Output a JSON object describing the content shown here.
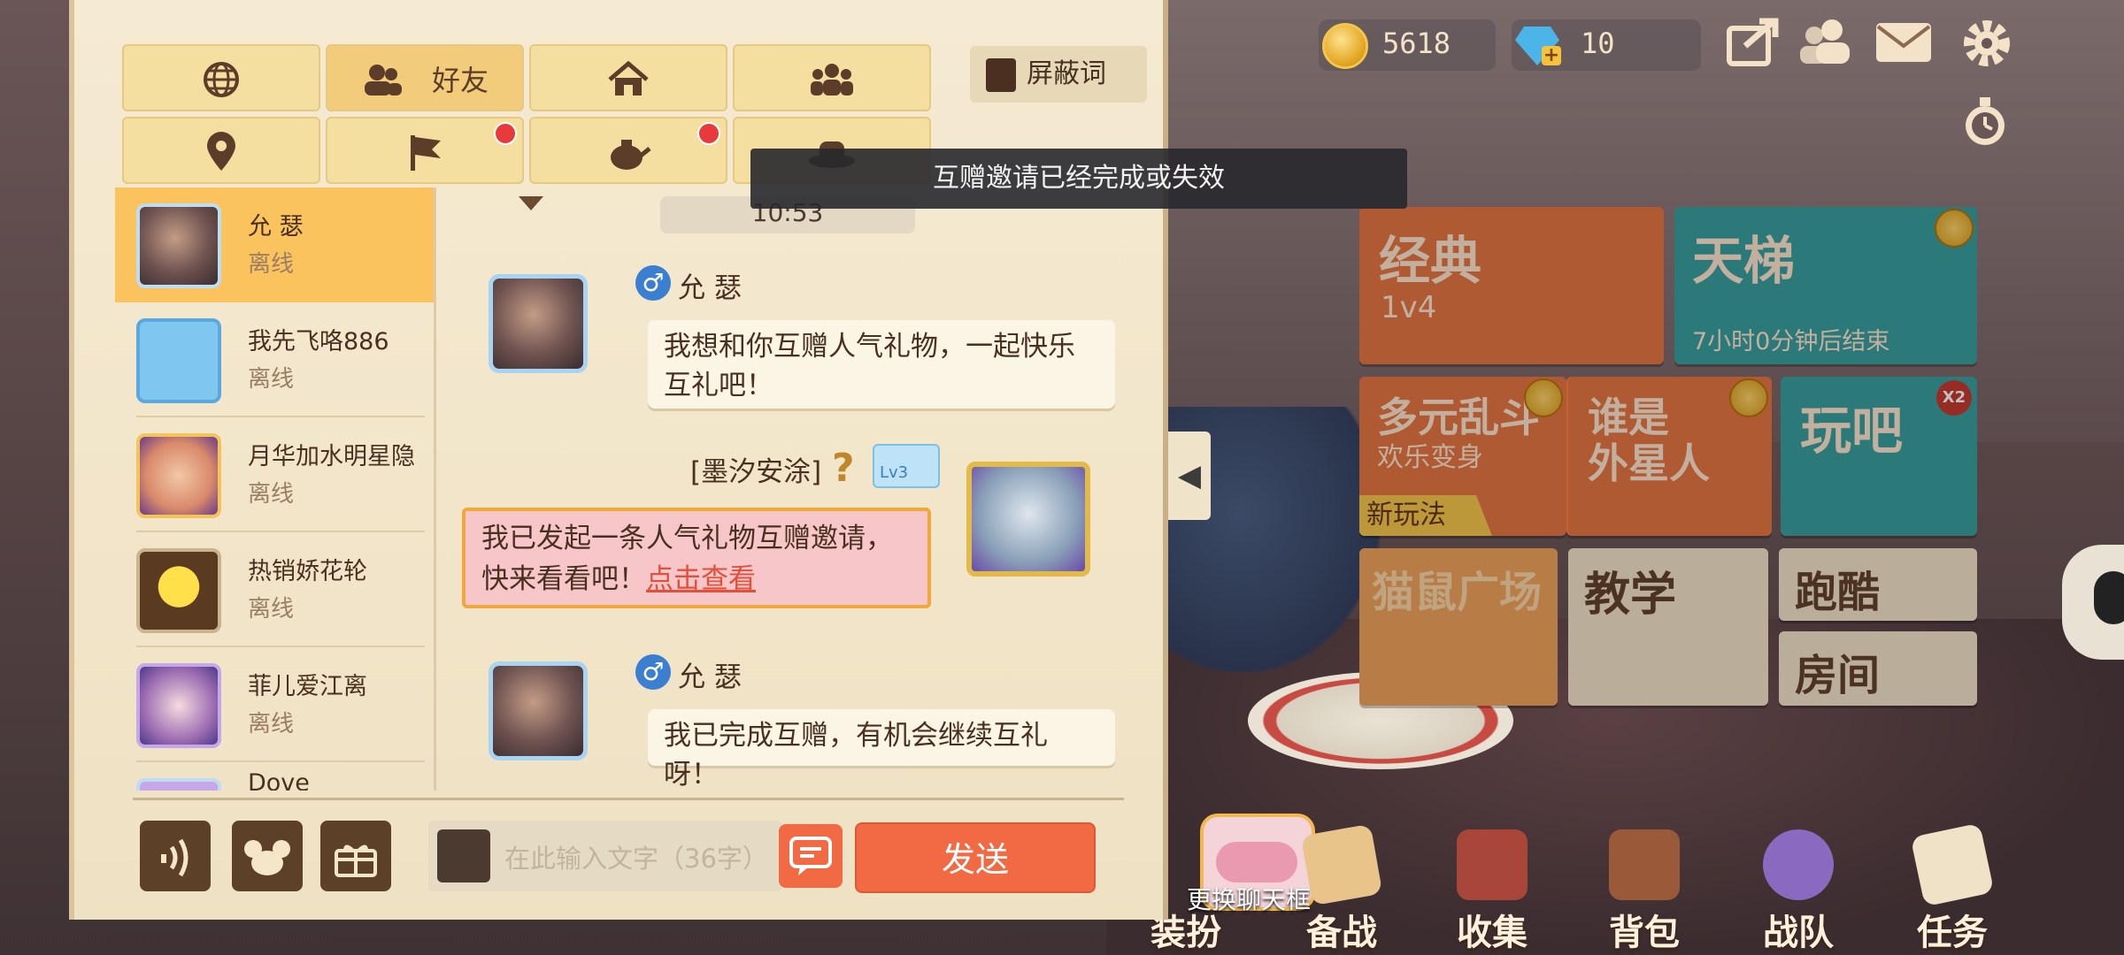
{
  "hud": {
    "coins": "5618",
    "gems": "10",
    "icons": [
      "share-icon",
      "friends-icon",
      "mail-icon",
      "settings-icon",
      "alarm-clock-icon"
    ]
  },
  "modes": [
    {
      "title": "经典",
      "sub": "1v4"
    },
    {
      "title": "天梯",
      "sub": "7小时0分钟后结束"
    },
    {
      "title": "多元乱斗",
      "sub": "欢乐变身",
      "tag": "新玩法"
    },
    {
      "title": "谁是",
      "sub": "外星人"
    },
    {
      "title": "玩吧",
      "badge": "X2"
    },
    {
      "title": "猫鼠广场"
    },
    {
      "title": "教学"
    },
    {
      "title": "跑酷"
    },
    {
      "title": "房间"
    }
  ],
  "bottom_nav": [
    "装扮",
    "备战",
    "收集",
    "背包",
    "战队",
    "任务"
  ],
  "chat_frame_label": "更换聊天框",
  "panel": {
    "tabs_row1": [
      {
        "icon": "globe-icon",
        "label": ""
      },
      {
        "icon": "friends-icon",
        "label": "好友"
      },
      {
        "icon": "house-icon",
        "label": ""
      },
      {
        "icon": "group-icon",
        "label": ""
      }
    ],
    "tabs_row2": [
      {
        "icon": "location-icon",
        "label": ""
      },
      {
        "icon": "flag-icon",
        "label": ""
      },
      {
        "icon": "teapot-icon",
        "label": ""
      },
      {
        "icon": "hat-icon",
        "label": ""
      }
    ],
    "block_words": "屏蔽词",
    "time": "10:53",
    "friends": [
      {
        "name": "允 瑟",
        "status": "离线"
      },
      {
        "name": "我先飞咯886",
        "status": "离线"
      },
      {
        "name": "月华加水明星隐",
        "status": "离线"
      },
      {
        "name": "热销娇花轮",
        "status": "离线"
      },
      {
        "name": "菲儿爱江离",
        "status": "离线"
      },
      {
        "name": "Dove",
        "status": ""
      }
    ],
    "messages": [
      {
        "sender": "允 瑟",
        "text": "我想和你互赠人气礼物，一起快乐互礼吧！"
      },
      {
        "sender": "[墨汐安涂]",
        "level": "Lv3",
        "text": "我已发起一条人气礼物互赠邀请，快来看看吧！",
        "link": "点击查看"
      },
      {
        "sender": "允 瑟",
        "text": "我已完成互赠，有机会继续互礼呀！"
      }
    ],
    "input_placeholder": "在此输入文字（36字）",
    "send": "发送"
  },
  "toast": "互赠邀请已经完成或失效",
  "colors": {
    "accent": "#f26a43",
    "active_tab": "#fbc35e",
    "panel_bg": "#f5ead2"
  }
}
